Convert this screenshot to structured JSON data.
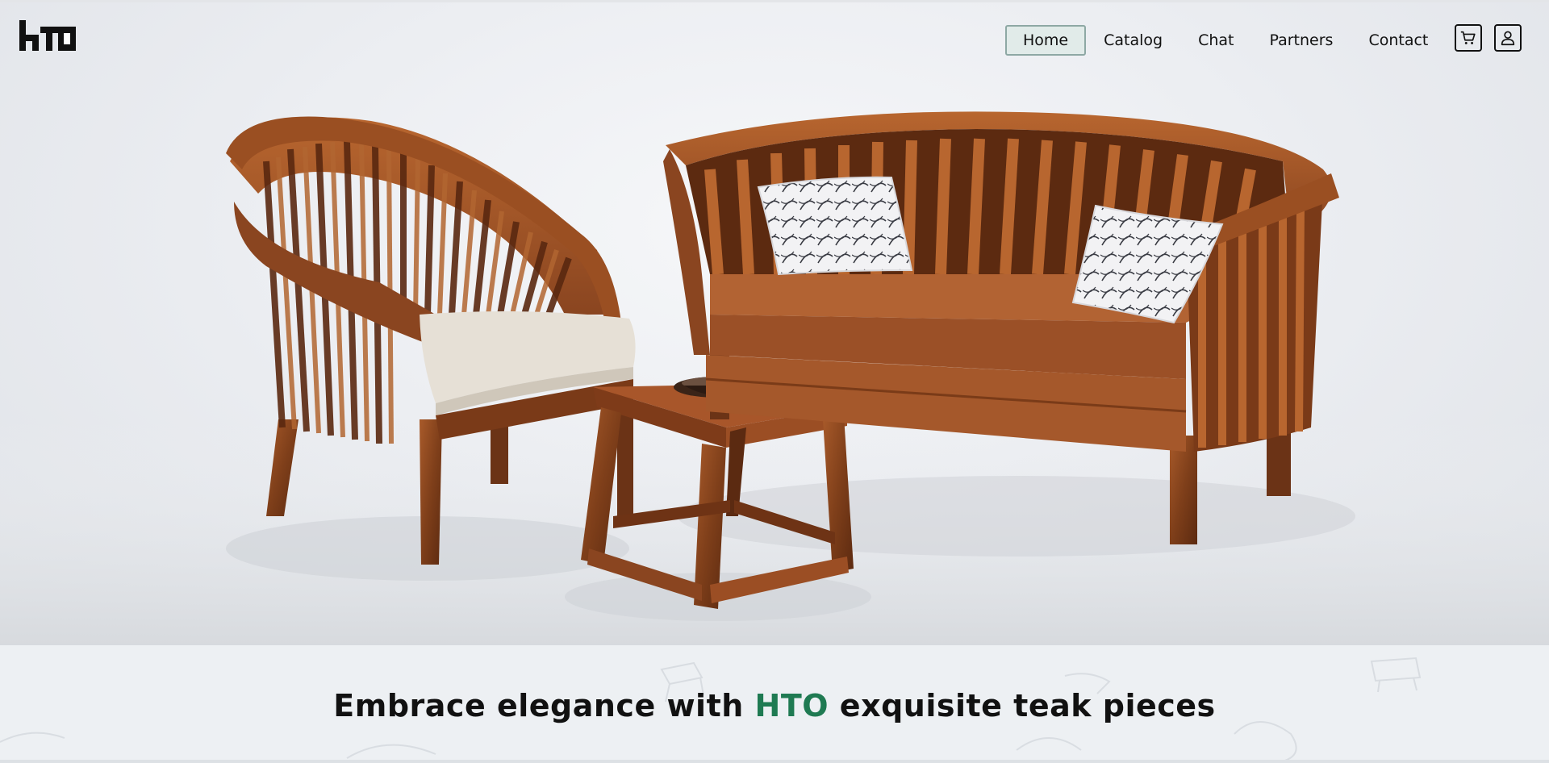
{
  "brand": {
    "logo_text": "hTO"
  },
  "nav": {
    "items": [
      {
        "label": "Home",
        "active": true
      },
      {
        "label": "Catalog",
        "active": false
      },
      {
        "label": "Chat",
        "active": false
      },
      {
        "label": "Partners",
        "active": false
      },
      {
        "label": "Contact",
        "active": false
      }
    ],
    "icons": [
      "cart-icon",
      "user-icon"
    ]
  },
  "hero": {
    "image": "teak-furniture-set-armchair-sofa-side-table"
  },
  "tagline": {
    "before": "Embrace elegance with ",
    "brand": "HTO",
    "after": " exquisite teak pieces"
  },
  "colors": {
    "brand_green": "#1f7a52",
    "active_nav_bg": "#e1ebe9",
    "active_nav_border": "#8ea8a4",
    "band_bg": "#edf0f3",
    "teak": "#8a4a22"
  }
}
